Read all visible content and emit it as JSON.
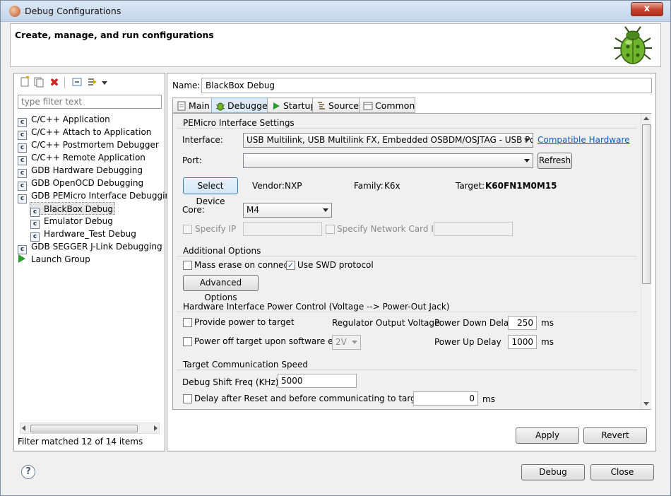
{
  "window": {
    "title": "Debug Configurations",
    "close_label": "x"
  },
  "header": {
    "title": "Create, manage, and run configurations"
  },
  "left": {
    "filter_placeholder": "type filter text",
    "tree": [
      {
        "label": "C/C++ Application"
      },
      {
        "label": "C/C++ Attach to Application"
      },
      {
        "label": "C/C++ Postmortem Debugger"
      },
      {
        "label": "C/C++ Remote Application"
      },
      {
        "label": "GDB Hardware Debugging"
      },
      {
        "label": "GDB OpenOCD Debugging"
      },
      {
        "label": "GDB PEMicro Interface Debugging"
      },
      {
        "label": "BlackBox Debug"
      },
      {
        "label": "Emulator Debug"
      },
      {
        "label": "Hardware_Test Debug"
      },
      {
        "label": "GDB SEGGER J-Link Debugging"
      },
      {
        "label": "Launch Group"
      }
    ],
    "status": "Filter matched 12 of 14 items"
  },
  "config": {
    "name_label": "Name:",
    "name_value": "BlackBox Debug",
    "tabs": [
      {
        "label": "Main"
      },
      {
        "label": "Debugger"
      },
      {
        "label": "Startup"
      },
      {
        "label": "Source"
      },
      {
        "label": "Common"
      }
    ],
    "active_tab": "Debugger",
    "pemicro": {
      "title": "PEMicro Interface Settings",
      "interface_label": "Interface:",
      "interface_value": "USB Multilink, USB Multilink FX, Embedded OSBDM/OSJTAG - USB Port",
      "compatible_link": "Compatible Hardware",
      "port_label": "Port:",
      "port_value": "",
      "refresh_label": "Refresh",
      "select_device_label": "Select Device",
      "vendor_label": "Vendor:",
      "vendor_value": "NXP",
      "family_label": "Family:",
      "family_value": "K6x",
      "target_label": "Target:",
      "target_value": "K60FN1M0M15",
      "core_label": "Core:",
      "core_value": "M4",
      "specify_ip_label": "Specify IP",
      "specify_nic_label": "Specify Network Card IP"
    },
    "additional": {
      "title": "Additional Options",
      "mass_erase_label": "Mass erase on connect",
      "mass_erase_checked": false,
      "swd_label": "Use SWD protocol",
      "swd_checked": true,
      "advanced_label": "Advanced Options"
    },
    "power": {
      "title": "Hardware Interface Power Control (Voltage --> Power-Out Jack)",
      "provide_power_label": "Provide power to target",
      "regulator_label": "Regulator Output Voltage",
      "power_down_label": "Power Down Delay",
      "power_down_value": "250",
      "power_down_unit": "ms",
      "power_off_label": "Power off target upon software exit",
      "voltage_value": "2V",
      "power_up_label": "Power Up Delay",
      "power_up_value": "1000",
      "power_up_unit": "ms"
    },
    "speed": {
      "title": "Target Communication Speed",
      "shift_label": "Debug Shift Freq (KHz)",
      "shift_value": "5000",
      "delay_label": "Delay after Reset and before communicating to target for",
      "delay_value": "0",
      "delay_unit": "ms"
    },
    "apply_label": "Apply",
    "revert_label": "Revert"
  },
  "footer": {
    "debug_label": "Debug",
    "close_label": "Close",
    "help_label": "?"
  },
  "colors": {
    "link": "#0b5ec2",
    "selection": "#e6e6e6",
    "check": "#1f4f8f"
  }
}
